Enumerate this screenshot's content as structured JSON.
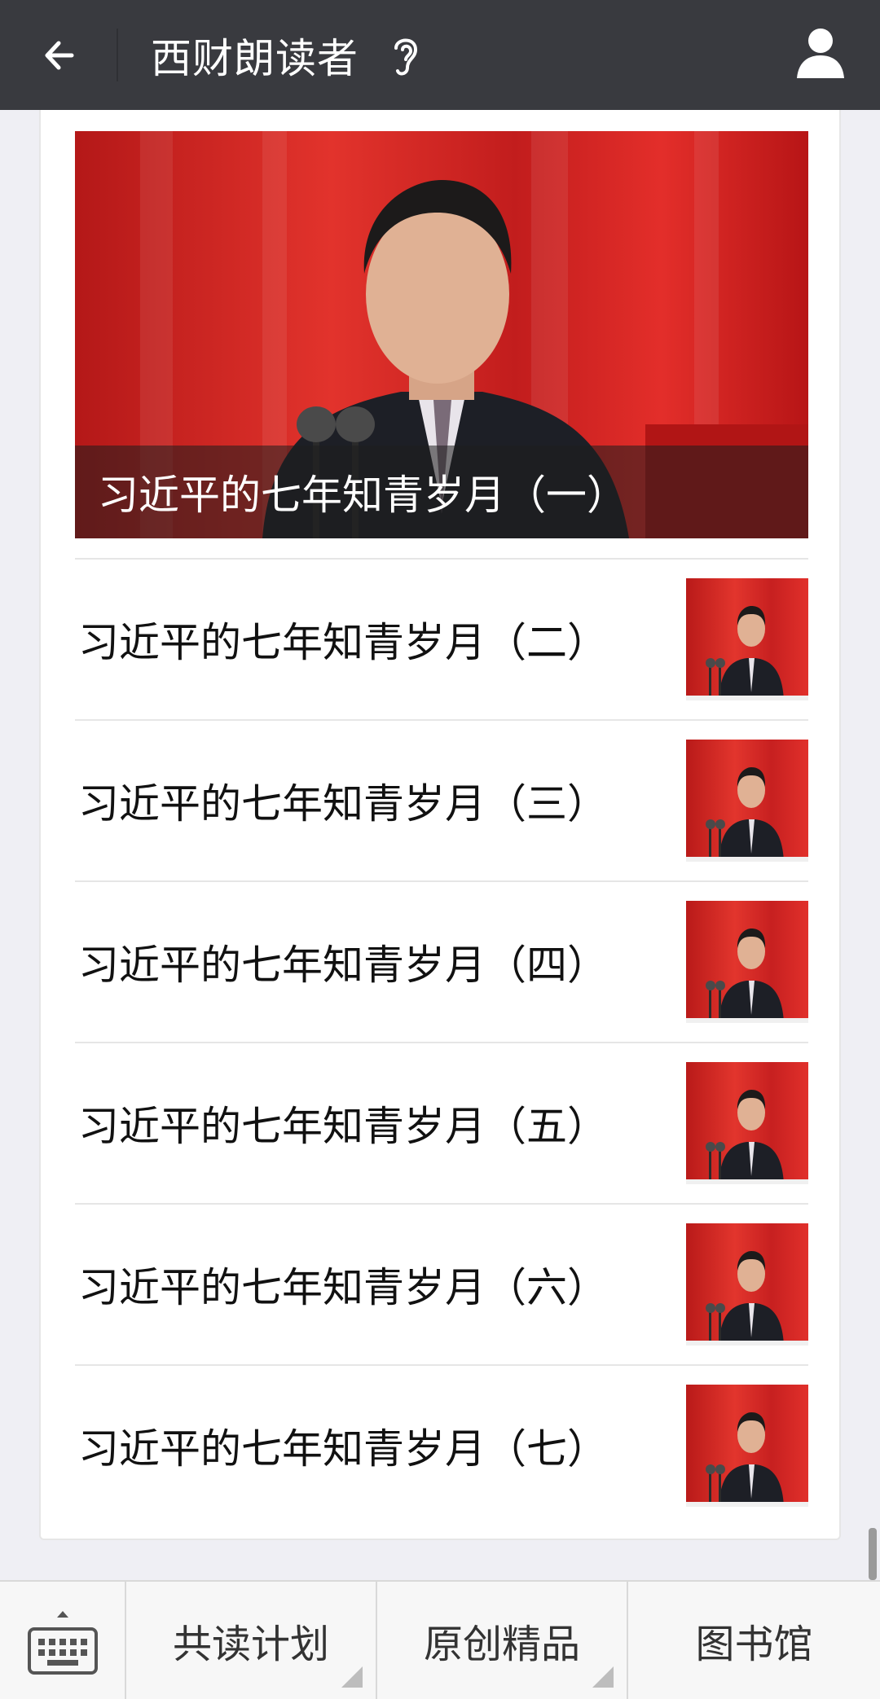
{
  "header": {
    "title": "西财朗读者"
  },
  "articles": {
    "featured": "习近平的七年知青岁月（一）",
    "items": [
      "习近平的七年知青岁月（二）",
      "习近平的七年知青岁月（三）",
      "习近平的七年知青岁月（四）",
      "习近平的七年知青岁月（五）",
      "习近平的七年知青岁月（六）",
      "习近平的七年知青岁月（七）"
    ]
  },
  "bottom_menu": {
    "items": [
      "共读计划",
      "原创精品",
      "图书馆"
    ]
  },
  "colors": {
    "header_bg": "#393a3f",
    "page_bg": "#efeff4",
    "cover_red": "#e2332c"
  },
  "icons": [
    "back-arrow-icon",
    "ear-icon",
    "profile-icon",
    "keyboard-icon"
  ]
}
